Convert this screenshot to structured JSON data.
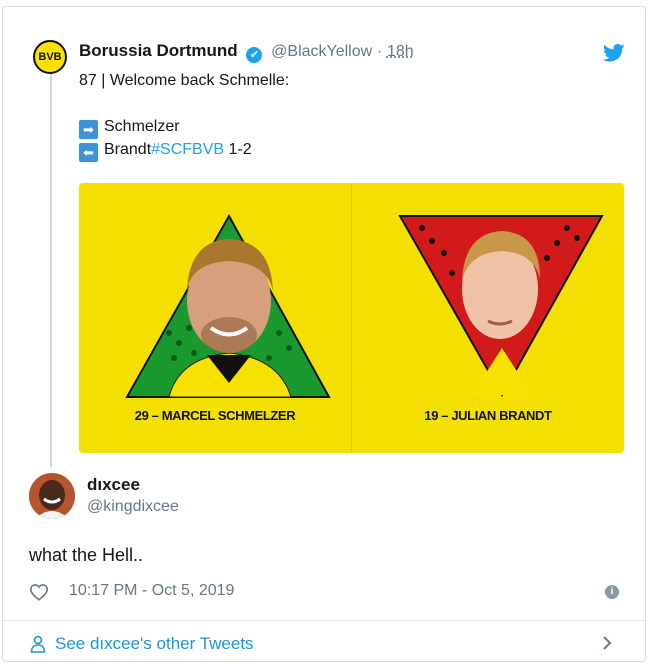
{
  "quoted_tweet": {
    "avatar_text": "BVB",
    "author_name": "Borussia Dortmund",
    "verified_glyph": "✔",
    "handle": "@BlackYellow",
    "separator": "·",
    "time": "18h",
    "line1": "87 | Welcome back Schmelle:",
    "line2_text": "Schmelzer",
    "line2_icon": "arrow-right-icon",
    "line3_text": "Brandt",
    "line3_hashtag": "#SCFBVB",
    "line3_score": " 1-2",
    "line3_icon": "arrow-left-icon",
    "media": {
      "left_player": "29 – MARCEL SCHMELZER",
      "right_player": "19 – JULIAN BRANDT"
    }
  },
  "tweet": {
    "author_name": "dıxcee",
    "handle": "@kingdixcee",
    "text": "what the Hell..",
    "timestamp": "10:17 PM - Oct 5, 2019"
  },
  "footer": {
    "link_text": "See dıxcee's other Tweets"
  },
  "colors": {
    "accent": "#1da1f2",
    "bvb_yellow": "#fde100",
    "green_triangle": "#1a9a2e",
    "red_triangle": "#d21a1a"
  }
}
